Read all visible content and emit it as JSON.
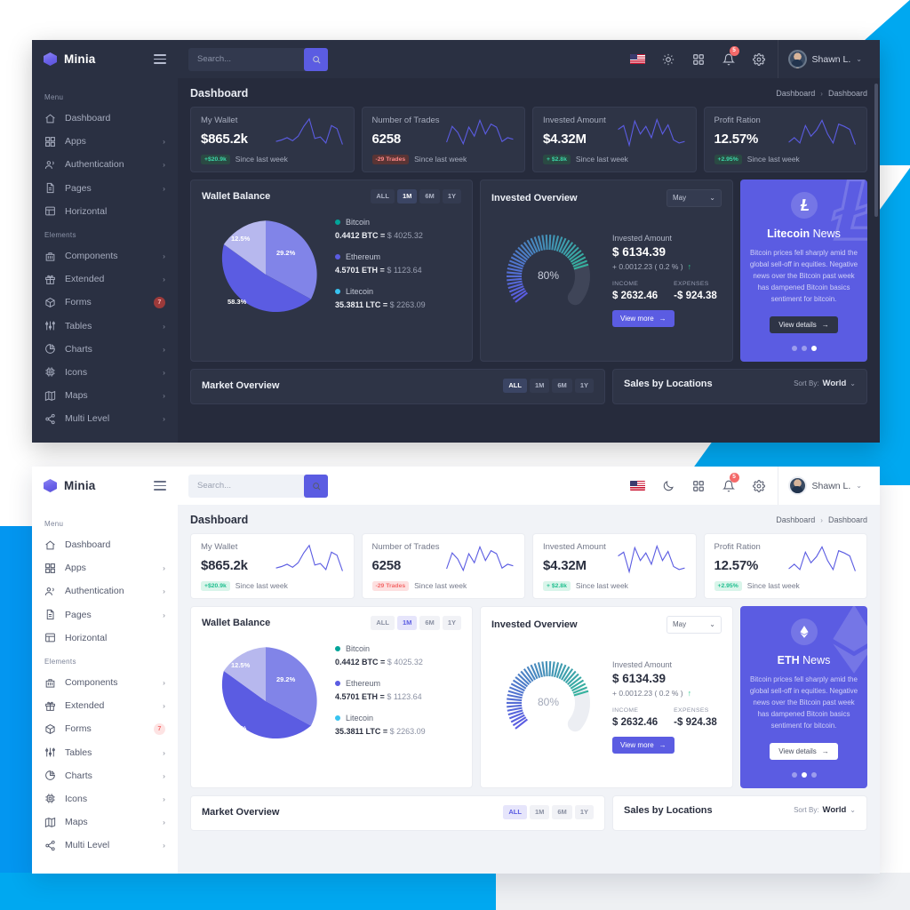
{
  "brand": {
    "name": "Minia",
    "logo_icon": "cube-icon",
    "menu_toggle_icon": "hamburger-icon"
  },
  "search": {
    "placeholder": "Search...",
    "value": "",
    "button_icon": "search-icon"
  },
  "topbar": {
    "flag_icon": "us-flag-icon",
    "theme_icon_dark_panel": "sun-icon",
    "theme_icon_light_panel": "moon-icon",
    "apps_icon": "grid-apps-icon",
    "bell_icon": "bell-icon",
    "notification_count": "5",
    "settings_icon": "gear-icon",
    "profile_name": "Shawn L.",
    "profile_caret": "⌄"
  },
  "sidebar": {
    "menu_heading": "Menu",
    "elements_heading": "Elements",
    "menu_items": [
      {
        "label": "Dashboard",
        "icon": "home-icon",
        "arrow": ""
      },
      {
        "label": "Apps",
        "icon": "grid-icon",
        "arrow": "›"
      },
      {
        "label": "Authentication",
        "icon": "users-icon",
        "arrow": "›"
      },
      {
        "label": "Pages",
        "icon": "file-icon",
        "arrow": "›"
      },
      {
        "label": "Horizontal",
        "icon": "layout-icon",
        "arrow": ""
      }
    ],
    "element_items": [
      {
        "label": "Components",
        "icon": "briefcase-icon",
        "arrow": "›",
        "badge": ""
      },
      {
        "label": "Extended",
        "icon": "gift-icon",
        "arrow": "›",
        "badge": ""
      },
      {
        "label": "Forms",
        "icon": "box-icon",
        "arrow": "",
        "badge": "7"
      },
      {
        "label": "Tables",
        "icon": "sliders-icon",
        "arrow": "›",
        "badge": ""
      },
      {
        "label": "Charts",
        "icon": "pie-chart-icon",
        "arrow": "›",
        "badge": ""
      },
      {
        "label": "Icons",
        "icon": "cpu-icon",
        "arrow": "›",
        "badge": ""
      },
      {
        "label": "Maps",
        "icon": "map-icon",
        "arrow": "›",
        "badge": ""
      },
      {
        "label": "Multi Level",
        "icon": "share-icon",
        "arrow": "›",
        "badge": ""
      }
    ]
  },
  "page": {
    "title": "Dashboard",
    "breadcrumb_root": "Dashboard",
    "breadcrumb_sep": "›",
    "breadcrumb_current": "Dashboard"
  },
  "stats": [
    {
      "title": "My Wallet",
      "value": "$865.2k",
      "pill": "+$20.9k",
      "pill_dir": "up",
      "note": "Since last week"
    },
    {
      "title": "Number of Trades",
      "value": "6258",
      "pill": "-29 Trades",
      "pill_dir": "down",
      "note": "Since last week"
    },
    {
      "title": "Invested Amount",
      "value": "$4.32M",
      "pill": "+ $2.8k",
      "pill_dir": "up",
      "note": "Since last week"
    },
    {
      "title": "Profit Ration",
      "value": "12.57%",
      "pill": "+2.95%",
      "pill_dir": "up",
      "note": "Since last week"
    }
  ],
  "wallet": {
    "title": "Wallet Balance",
    "tabs": [
      "ALL",
      "1M",
      "6M",
      "1Y"
    ],
    "active_tab": "1M",
    "coins": [
      {
        "name": "Bitcoin",
        "amount": "0.4412 BTC =",
        "usd": "$ 4025.32",
        "color": "#02a499",
        "pct": "29.2%"
      },
      {
        "name": "Ethereum",
        "amount": "4.5701 ETH =",
        "usd": "$ 1123.64",
        "color": "#5b5ce2",
        "pct": "58.3%"
      },
      {
        "name": "Litecoin",
        "amount": "35.3811 LTC =",
        "usd": "$ 2263.09",
        "color": "#38c3f0",
        "pct": "12.5%"
      }
    ]
  },
  "chart_data": [
    {
      "type": "pie",
      "title": "Wallet Balance",
      "categories": [
        "Bitcoin",
        "Ethereum",
        "Litecoin"
      ],
      "values": [
        29.2,
        58.3,
        12.5
      ],
      "labels": [
        "29.2%",
        "58.3%",
        "12.5%"
      ],
      "colors": [
        "#8184e8",
        "#5b5ce2",
        "#b7b8ee"
      ],
      "legend": "right"
    },
    {
      "type": "gauge",
      "title": "Invested Overview",
      "value": 80,
      "label": "80%",
      "ylim": [
        0,
        100
      ],
      "colors": [
        "#5b5ce2",
        "#2bc98b"
      ]
    },
    {
      "type": "line",
      "title": "My Wallet",
      "values": [
        18,
        22,
        26,
        20,
        28,
        44,
        68,
        24,
        26,
        16,
        48,
        42,
        12
      ],
      "color": "#5b5ce2",
      "grid": false
    },
    {
      "type": "line",
      "title": "Number of Trades",
      "values": [
        14,
        44,
        34,
        12,
        42,
        26,
        62,
        30,
        50,
        44,
        16,
        22,
        20
      ],
      "color": "#5b5ce2",
      "grid": false
    },
    {
      "type": "line",
      "title": "Invested Amount",
      "values": [
        40,
        44,
        8,
        54,
        30,
        46,
        26,
        56,
        30,
        48,
        20,
        16,
        18
      ],
      "color": "#5b5ce2",
      "grid": false
    },
    {
      "type": "line",
      "title": "Profit Ration",
      "values": [
        16,
        22,
        14,
        46,
        26,
        36,
        62,
        30,
        14,
        52,
        46,
        40,
        10
      ],
      "color": "#5b5ce2",
      "grid": false
    }
  ],
  "invested": {
    "title": "Invested Overview",
    "month": "May",
    "month_caret": "⌄",
    "gauge_label": "80%",
    "amount_label": "Invested Amount",
    "amount_value": "$ 6134.39",
    "delta": "+ 0.0012.23 ( 0.2 % )",
    "delta_arrow": "↑",
    "income_label": "INCOME",
    "income_value": "$ 2632.46",
    "expenses_label": "EXPENSES",
    "expenses_value": "-$ 924.38",
    "view_more": "View more",
    "view_more_arrow": "→"
  },
  "news_dark": {
    "coin": "Litecoin",
    "suffix": "News",
    "icon": "litecoin-icon",
    "text": "Bitcoin prices fell sharply amid the global sell-off in equities. Negative news over the Bitcoin past week has dampened Bitcoin basics sentiment for bitcoin.",
    "button": "View details",
    "button_arrow": "→",
    "active_dot": 2
  },
  "news_light": {
    "coin": "ETH",
    "suffix": "News",
    "icon": "ethereum-icon",
    "text": "Bitcoin prices fell sharply amid the global sell-off in equities. Negative news over the Bitcoin past week has dampened Bitcoin basics sentiment for bitcoin.",
    "button": "View details",
    "button_arrow": "→",
    "active_dot": 1
  },
  "market": {
    "title": "Market Overview",
    "tabs": [
      "ALL",
      "1M",
      "6M",
      "1Y"
    ],
    "active_tab": "ALL"
  },
  "sales": {
    "title": "Sales by Locations",
    "sort_label": "Sort By:",
    "sort_value": "World",
    "sort_caret": "⌄"
  },
  "colors": {
    "accent": "#5b5ce2",
    "dark_panel_bg": "#2a3042",
    "dark_content_bg": "#262b3c",
    "light_panel_bg": "#f1f3f7",
    "cyan": "#00A8F0",
    "success": "#2bc98b",
    "danger": "#f46a6a"
  }
}
